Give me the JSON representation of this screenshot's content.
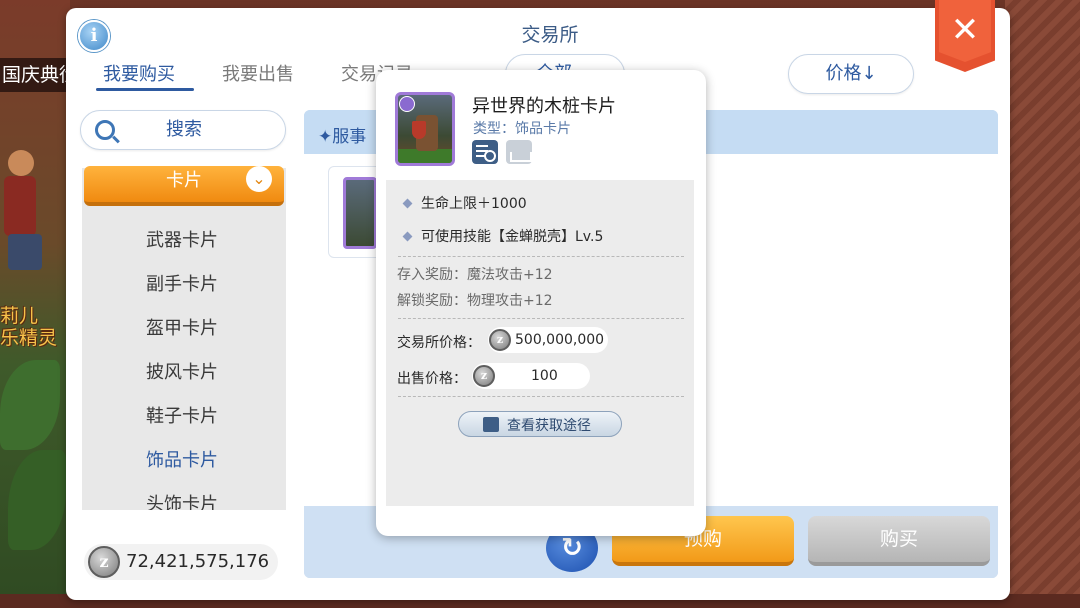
{
  "background": {
    "banner_left": "国庆典衍",
    "npc_name_line1": "莉儿",
    "npc_name_line2": "乐精灵"
  },
  "window": {
    "title": "交易所",
    "info_icon": "i",
    "close_icon": "✕"
  },
  "tabs": [
    {
      "label": "我要购买",
      "active": true
    },
    {
      "label": "我要出售",
      "active": false
    },
    {
      "label": "交易记录",
      "active": false
    }
  ],
  "filters": {
    "all_label": "全部",
    "price_sort_label": "价格↓"
  },
  "sidebar": {
    "search_label": "搜索",
    "category_header": "卡片",
    "categories": [
      {
        "label": "武器卡片",
        "active": false
      },
      {
        "label": "副手卡片",
        "active": false
      },
      {
        "label": "盔甲卡片",
        "active": false
      },
      {
        "label": "披风卡片",
        "active": false
      },
      {
        "label": "鞋子卡片",
        "active": false
      },
      {
        "label": "饰品卡片",
        "active": true
      },
      {
        "label": "头饰卡片",
        "active": false
      }
    ],
    "zeny_amount": "72,421,575,176"
  },
  "list": {
    "header_label": "✦服事",
    "preorder_label": "预购",
    "buy_label": "购买"
  },
  "tooltip": {
    "item_name": "异世界的木桩卡片",
    "item_type": "类型：饰品卡片",
    "attributes": [
      "生命上限＋1000",
      "可使用技能【金蝉脱壳】Lv.5"
    ],
    "deposit_bonus_label": "存入奖励：",
    "deposit_bonus_value": "魔法攻击+12",
    "unlock_bonus_label": "解锁奖励：",
    "unlock_bonus_value": "物理攻击+12",
    "exchange_price_label": "交易所价格：",
    "exchange_price_value": "500,000,000",
    "sell_price_label": "出售价格：",
    "sell_price_value": "100",
    "source_button_label": "查看获取途径"
  },
  "colors": {
    "accent_blue": "#2e5aa0",
    "orange": "#f29a18",
    "close_red": "#e5512f",
    "card_border_purple": "#a07ad8"
  }
}
